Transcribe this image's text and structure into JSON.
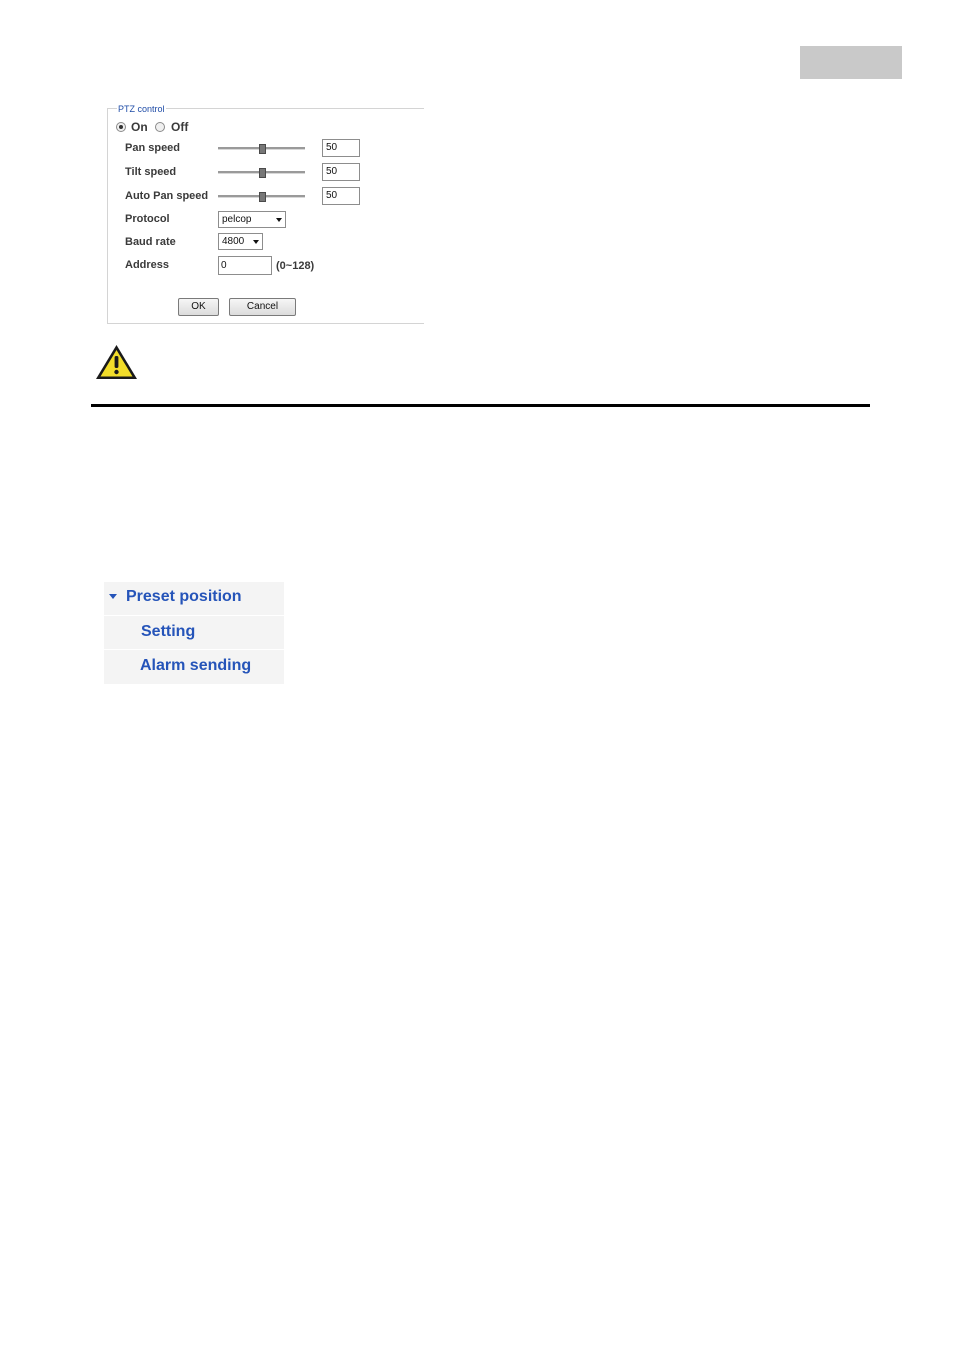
{
  "ptz": {
    "legend": "PTZ control",
    "on_label": "On",
    "off_label": "Off",
    "selected": "On",
    "rows": [
      {
        "label": "Pan speed",
        "value": "50",
        "slider_level": 0.5
      },
      {
        "label": "Tilt speed",
        "value": "50",
        "slider_level": 0.5
      },
      {
        "label": "Auto Pan speed",
        "value": "50",
        "slider_level": 0.5
      }
    ],
    "protocol_label": "Protocol",
    "protocol_value": "pelcop",
    "baud_label": "Baud rate",
    "baud_value": "4800",
    "address_label": "Address",
    "address_value": "0",
    "address_hint": "(0~128)",
    "ok_label": "OK",
    "cancel_label": "Cancel"
  },
  "icons": {
    "warning": "warning-icon",
    "menu_caret": "caret-down-icon"
  },
  "menu": {
    "title": "Preset position",
    "items": [
      "Setting",
      "Alarm sending"
    ]
  },
  "colors": {
    "link_blue": "#2554b9",
    "legend_blue": "#1f4ca7",
    "warning_yellow": "#f2dd2a",
    "label_gray": "#3a3a3a"
  }
}
